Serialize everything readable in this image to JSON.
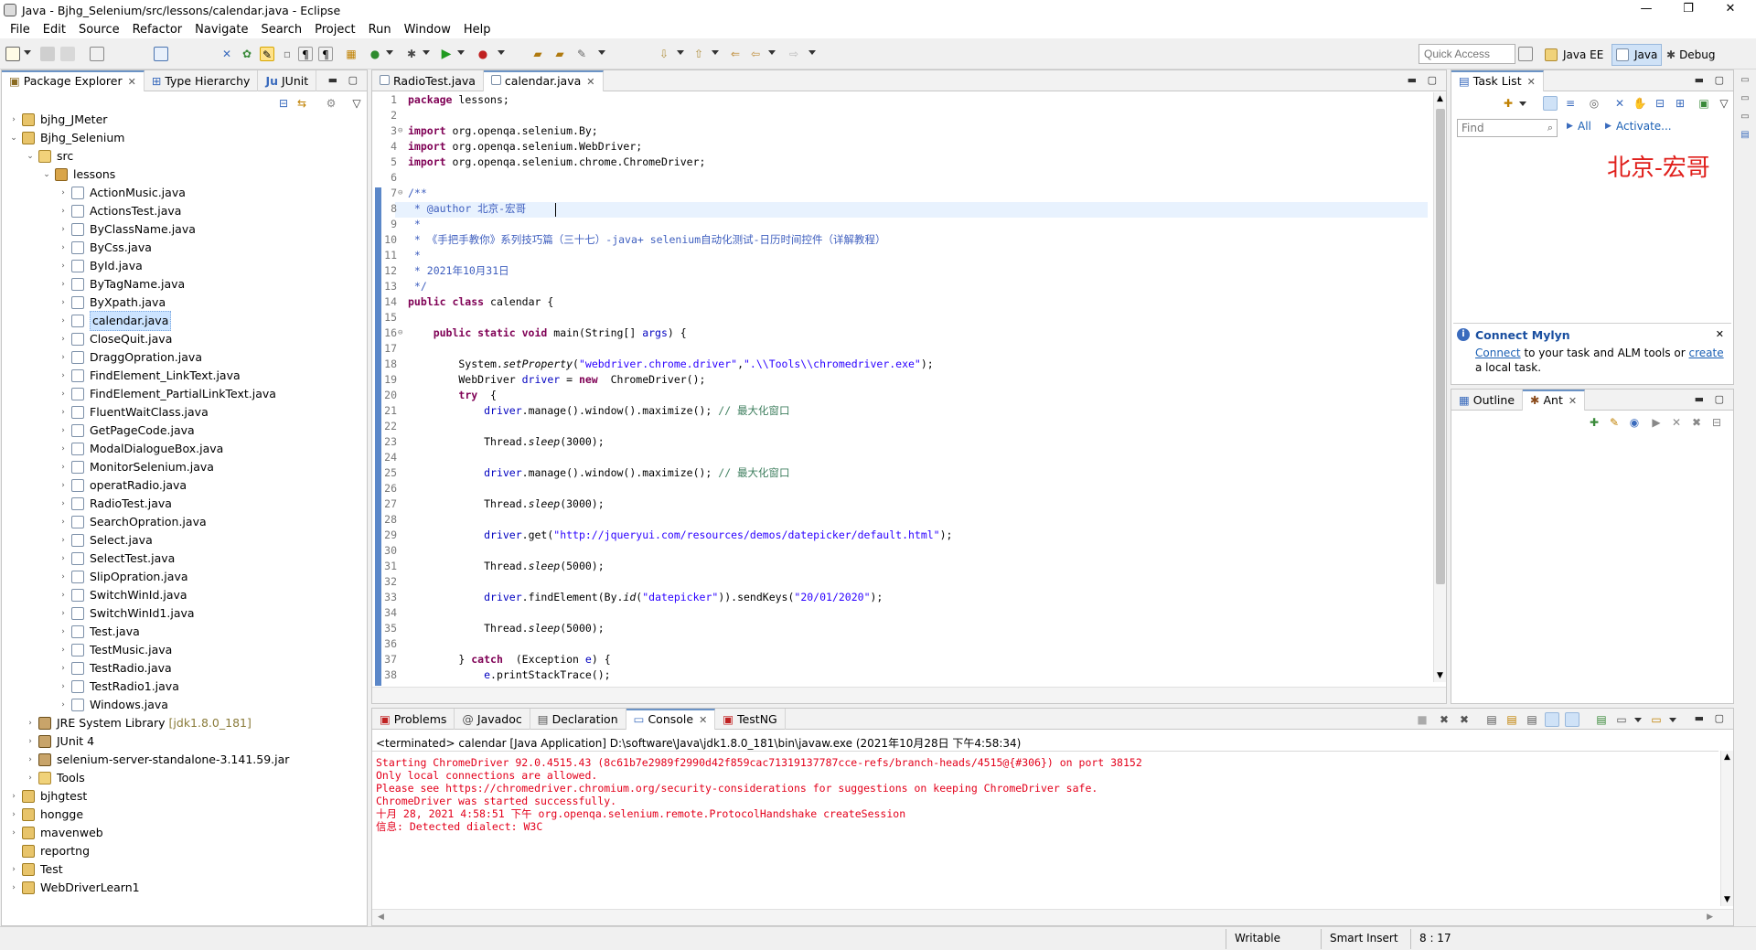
{
  "window": {
    "title": "Java - Bjhg_Selenium/src/lessons/calendar.java - Eclipse",
    "minimize": "—",
    "maximize": "❐",
    "close": "✕"
  },
  "menu": [
    "File",
    "Edit",
    "Source",
    "Refactor",
    "Navigate",
    "Search",
    "Project",
    "Run",
    "Window",
    "Help"
  ],
  "quick_access": {
    "placeholder": "Quick Access"
  },
  "perspectives": [
    "Java EE",
    "Java",
    "Debug"
  ],
  "package_explorer": {
    "tabs": [
      "Package Explorer",
      "Type Hierarchy",
      "JUnit"
    ],
    "junit_prefix": "Ju",
    "projects_top": [
      "bjhg_JMeter",
      "Bjhg_Selenium"
    ],
    "src": "src",
    "package": "lessons",
    "files": [
      "ActionMusic.java",
      "ActionsTest.java",
      "ByClassName.java",
      "ByCss.java",
      "ById.java",
      "ByTagName.java",
      "ByXpath.java",
      "calendar.java",
      "CloseQuit.java",
      "DraggOpration.java",
      "FindElement_LinkText.java",
      "FindElement_PartialLinkText.java",
      "FluentWaitClass.java",
      "GetPageCode.java",
      "ModalDialogueBox.java",
      "MonitorSelenium.java",
      "operatRadio.java",
      "RadioTest.java",
      "SearchOpration.java",
      "Select.java",
      "SelectTest.java",
      "SlipOpration.java",
      "SwitchWinId.java",
      "SwitchWinId1.java",
      "Test.java",
      "TestMusic.java",
      "TestRadio.java",
      "TestRadio1.java",
      "Windows.java"
    ],
    "jre": "JRE System Library",
    "jre_decor": "[jdk1.8.0_181]",
    "junit4": "JUnit 4",
    "selenium_jar": "selenium-server-standalone-3.141.59.jar",
    "tools": "Tools",
    "projects_bottom": [
      "bjhgtest",
      "hongge",
      "mavenweb",
      "reportng",
      "Test",
      "WebDriverLearn1"
    ]
  },
  "editor": {
    "tabs": [
      "RadioTest.java",
      "calendar.java"
    ],
    "line_numbers": [
      "1",
      "2",
      "3",
      "4",
      "5",
      "6",
      "7",
      "8",
      "9",
      "10",
      "11",
      "12",
      "13",
      "14",
      "15",
      "16",
      "17",
      "18",
      "19",
      "20",
      "21",
      "22",
      "23",
      "24",
      "25",
      "26",
      "27",
      "28",
      "29",
      "30",
      "31",
      "32",
      "33",
      "34",
      "35",
      "36",
      "37",
      "38"
    ],
    "fold_marks": {
      "3": "⊖",
      "7": "⊖",
      "16": "⊖"
    },
    "lines": [
      [
        [
          "kw",
          "package"
        ],
        [
          "",
          "lessons;"
        ]
      ],
      [],
      [
        [
          "kw",
          "import"
        ],
        [
          "",
          "org.openqa.selenium.By;"
        ]
      ],
      [
        [
          "kw",
          "import"
        ],
        [
          "",
          "org.openqa.selenium.WebDriver;"
        ]
      ],
      [
        [
          "kw",
          "import"
        ],
        [
          "",
          "org.openqa.selenium.chrome.ChromeDriver;"
        ]
      ],
      [],
      [
        [
          "cm",
          "/**"
        ]
      ],
      [
        [
          "cm",
          " * "
        ],
        [
          "cm",
          "@author"
        ],
        [
          "cm",
          " 北京-宏哥"
        ]
      ],
      [
        [
          "cm",
          " *"
        ]
      ],
      [
        [
          "cm",
          " * 《手把手教你》系列技巧篇（三十七）-java+ "
        ],
        [
          "cm",
          "selenium"
        ],
        [
          "cm",
          "自动化测试-日历时间控件（详解教程）"
        ]
      ],
      [
        [
          "cm",
          " *"
        ]
      ],
      [
        [
          "cm",
          " * 2021年10月31日"
        ]
      ],
      [
        [
          "cm",
          " */"
        ]
      ],
      [
        [
          "kw",
          "public class"
        ],
        [
          "",
          "calendar {"
        ]
      ],
      [],
      [
        [
          "",
          "    "
        ],
        [
          "kw",
          "public static void"
        ],
        [
          "",
          "main(String[] "
        ],
        [
          "fld",
          "args"
        ],
        [
          "",
          ") {"
        ]
      ],
      [],
      [
        [
          "",
          "        System."
        ],
        [
          "it",
          "setProperty"
        ],
        [
          "",
          "("
        ],
        [
          "str",
          "\"webdriver.chrome.driver\""
        ],
        [
          "",
          ","
        ],
        [
          "str",
          "\".\\\\Tools\\\\chromedriver.exe\""
        ],
        [
          "",
          ");"
        ]
      ],
      [
        [
          "",
          "        WebDriver "
        ],
        [
          "fld",
          "driver"
        ],
        [
          "",
          " = "
        ],
        [
          "kw",
          "new"
        ],
        [
          "",
          " ChromeDriver();"
        ]
      ],
      [
        [
          "",
          "        "
        ],
        [
          "kw",
          "try"
        ],
        [
          "",
          " {"
        ]
      ],
      [
        [
          "",
          "            "
        ],
        [
          "fld",
          "driver"
        ],
        [
          "",
          ".manage().window().maximize(); "
        ],
        [
          "cmg",
          "// 最大化窗口"
        ]
      ],
      [],
      [
        [
          "",
          "            Thread."
        ],
        [
          "it",
          "sleep"
        ],
        [
          "",
          "(3000);"
        ]
      ],
      [],
      [
        [
          "",
          "            "
        ],
        [
          "fld",
          "driver"
        ],
        [
          "",
          ".manage().window().maximize(); "
        ],
        [
          "cmg",
          "// 最大化窗口"
        ]
      ],
      [],
      [
        [
          "",
          "            Thread."
        ],
        [
          "it",
          "sleep"
        ],
        [
          "",
          "(3000);"
        ]
      ],
      [],
      [
        [
          "",
          "            "
        ],
        [
          "fld",
          "driver"
        ],
        [
          "",
          ".get("
        ],
        [
          "str",
          "\"http://jqueryui.com/resources/demos/datepicker/default.html\""
        ],
        [
          "",
          ");"
        ]
      ],
      [],
      [
        [
          "",
          "            Thread."
        ],
        [
          "it",
          "sleep"
        ],
        [
          "",
          "(5000);"
        ]
      ],
      [],
      [
        [
          "",
          "            "
        ],
        [
          "fld",
          "driver"
        ],
        [
          "",
          ".findElement(By."
        ],
        [
          "it",
          "id"
        ],
        [
          "",
          "("
        ],
        [
          "str",
          "\"datepicker\""
        ],
        [
          "",
          ")).sendKeys("
        ],
        [
          "str",
          "\"20/01/2020\""
        ],
        [
          "",
          ");"
        ]
      ],
      [],
      [
        [
          "",
          "            Thread."
        ],
        [
          "it",
          "sleep"
        ],
        [
          "",
          "(5000);"
        ]
      ],
      [],
      [
        [
          "",
          "        } "
        ],
        [
          "kw",
          "catch"
        ],
        [
          "",
          " (Exception "
        ],
        [
          "fld",
          "e"
        ],
        [
          "",
          ") {"
        ]
      ],
      [
        [
          "",
          "            "
        ],
        [
          "fld",
          "e"
        ],
        [
          "",
          ".printStackTrace();"
        ]
      ]
    ]
  },
  "task_list": {
    "tab": "Task List",
    "find_placeholder": "Find",
    "all": "All",
    "activate": "Activate...",
    "watermark": "北京-宏哥"
  },
  "mylyn": {
    "title": "Connect Mylyn",
    "connect": "Connect",
    "text1": " to your task and ALM tools or ",
    "create": "create",
    "text2": "a local task."
  },
  "outline": {
    "tabs": [
      "Outline",
      "Ant"
    ]
  },
  "console": {
    "tabs": [
      "Problems",
      "Javadoc",
      "Declaration",
      "Console",
      "TestNG"
    ],
    "header": "<terminated> calendar [Java Application] D:\\software\\Java\\jdk1.8.0_181\\bin\\javaw.exe (2021年10月28日 下午4:58:34)",
    "lines": [
      "Starting ChromeDriver 92.0.4515.43 (8c61b7e2989f2990d42f859cac71319137787cce-refs/branch-heads/4515@{#306}) on port 38152",
      "Only local connections are allowed.",
      "Please see https://chromedriver.chromium.org/security-considerations for suggestions on keeping ChromeDriver safe.",
      "ChromeDriver was started successfully.",
      "十月 28, 2021 4:58:51 下午 org.openqa.selenium.remote.ProtocolHandshake createSession",
      "信息: Detected dialect: W3C"
    ]
  },
  "status": {
    "writable": "Writable",
    "insert": "Smart Insert",
    "position": "8 : 17"
  }
}
